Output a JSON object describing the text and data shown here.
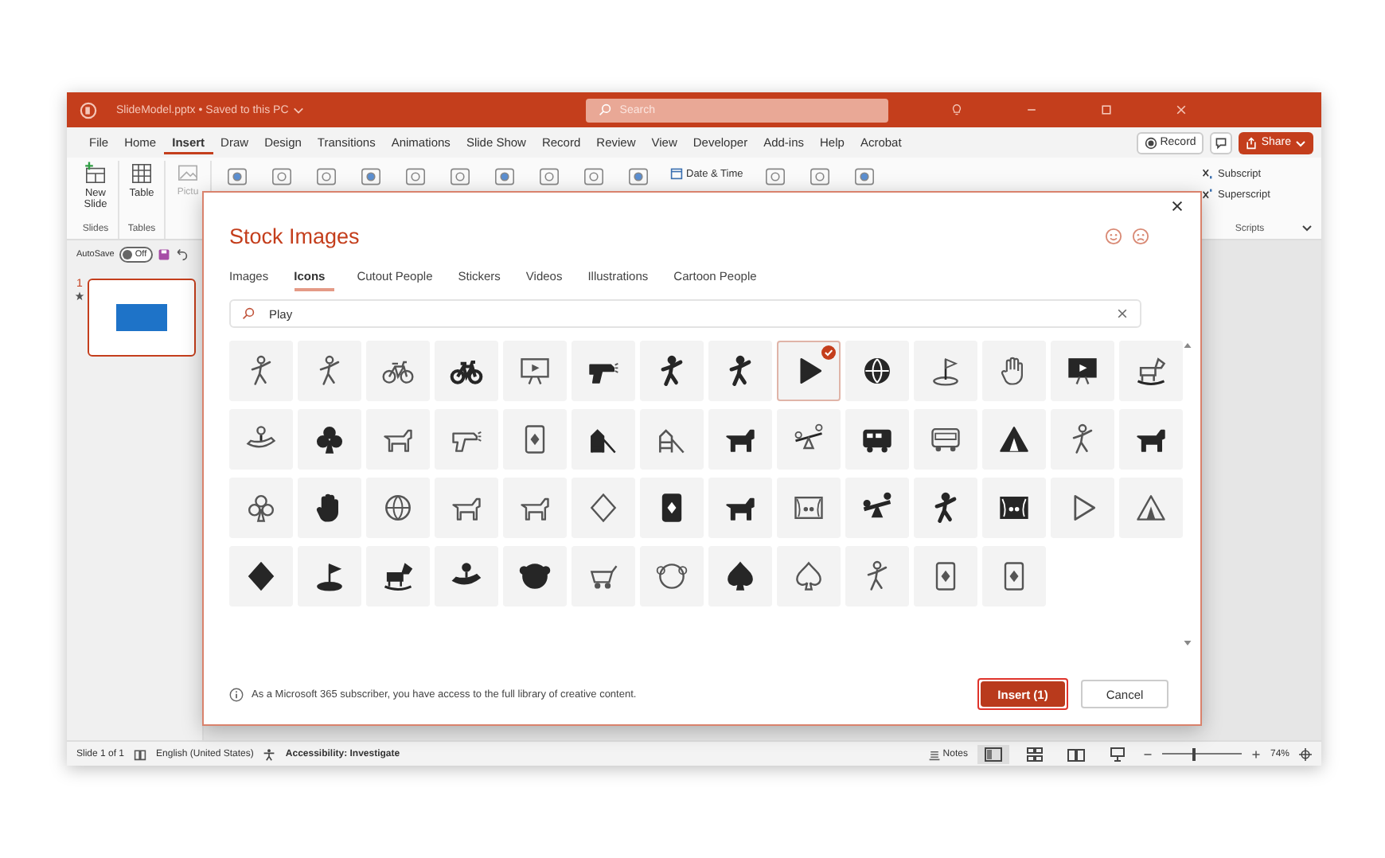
{
  "window": {
    "title": "SlideModel.pptx • Saved to this PC",
    "search": {
      "placeholder": "Search"
    }
  },
  "menu": [
    {
      "label": "File",
      "selected": false
    },
    {
      "label": "Home",
      "selected": false
    },
    {
      "label": "Insert",
      "selected": true
    },
    {
      "label": "Draw",
      "selected": false
    },
    {
      "label": "Design",
      "selected": false
    },
    {
      "label": "Transitions",
      "selected": false
    },
    {
      "label": "Animations",
      "selected": false
    },
    {
      "label": "Slide Show",
      "selected": false
    },
    {
      "label": "Record",
      "selected": false
    },
    {
      "label": "Review",
      "selected": false
    },
    {
      "label": "View",
      "selected": false
    },
    {
      "label": "Developer",
      "selected": false
    },
    {
      "label": "Add-ins",
      "selected": false
    },
    {
      "label": "Help",
      "selected": false
    },
    {
      "label": "Acrobat",
      "selected": false
    }
  ],
  "record_button": "Record",
  "share_button": "Share",
  "ribbon": {
    "new_slide": "New Slide",
    "table": "Table",
    "pictures": "Pictu",
    "slides_label": "Slides",
    "tables_label": "Tables",
    "date_time": "Date & Time",
    "subscript": "Subscript",
    "superscript": "Superscript",
    "scripts_label": "Scripts"
  },
  "autosave": {
    "label": "AutoSave",
    "on": false,
    "state_text": "Off"
  },
  "slides": [
    {
      "number": "1",
      "selected": true
    }
  ],
  "dialog": {
    "title": "Stock Images",
    "tabs": [
      {
        "label": "Images",
        "selected": false
      },
      {
        "label": "Icons",
        "selected": true
      },
      {
        "label": "Cutout People",
        "selected": false
      },
      {
        "label": "Stickers",
        "selected": false
      },
      {
        "label": "Videos",
        "selected": false
      },
      {
        "label": "Illustrations",
        "selected": false
      },
      {
        "label": "Cartoon People",
        "selected": false
      }
    ],
    "search": {
      "value": "Play"
    },
    "icons": [
      {
        "selected": false
      },
      {
        "selected": false
      },
      {
        "selected": false
      },
      {
        "selected": false
      },
      {
        "selected": false
      },
      {
        "selected": false
      },
      {
        "selected": false
      },
      {
        "selected": false
      },
      {
        "selected": true
      },
      {
        "selected": false
      },
      {
        "selected": false
      },
      {
        "selected": false
      },
      {
        "selected": false
      },
      {
        "selected": false
      },
      {
        "selected": false
      },
      {
        "selected": false
      },
      {
        "selected": false
      },
      {
        "selected": false
      },
      {
        "selected": false
      },
      {
        "selected": false
      },
      {
        "selected": false
      },
      {
        "selected": false
      },
      {
        "selected": false
      },
      {
        "selected": false
      },
      {
        "selected": false
      },
      {
        "selected": false
      },
      {
        "selected": false
      },
      {
        "selected": false
      },
      {
        "selected": false
      },
      {
        "selected": false
      },
      {
        "selected": false
      },
      {
        "selected": false
      },
      {
        "selected": false
      },
      {
        "selected": false
      },
      {
        "selected": false
      },
      {
        "selected": false
      },
      {
        "selected": false
      },
      {
        "selected": false
      },
      {
        "selected": false
      },
      {
        "selected": false
      },
      {
        "selected": false
      },
      {
        "selected": false
      },
      {
        "selected": false
      },
      {
        "selected": false
      },
      {
        "selected": false
      },
      {
        "selected": false
      },
      {
        "selected": false
      },
      {
        "selected": false
      },
      {
        "selected": false
      },
      {
        "selected": false
      },
      {
        "selected": false
      },
      {
        "selected": false
      },
      {
        "selected": false
      },
      {
        "selected": false
      }
    ],
    "note": "As a Microsoft 365 subscriber, you have access to the full library of creative content.",
    "insert_button": "Insert (1)",
    "cancel_button": "Cancel"
  },
  "status_bar": {
    "slide": "Slide 1 of 1",
    "language": "English (United States)",
    "accessibility": "Accessibility: Investigate",
    "notes": "Notes",
    "zoom_slider": {
      "level": 0.4
    },
    "zoom": "74%"
  }
}
